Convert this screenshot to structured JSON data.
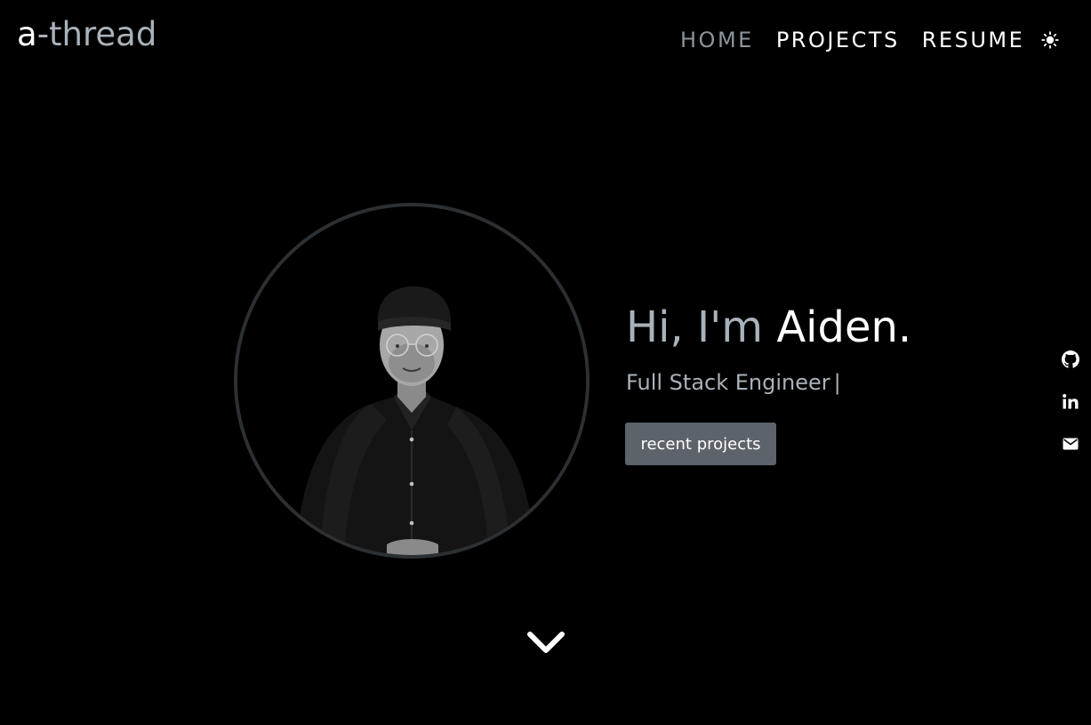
{
  "brand": {
    "first": "a",
    "rest": "-thread"
  },
  "nav": {
    "items": [
      {
        "label": "HOME",
        "active": true
      },
      {
        "label": "PROJECTS"
      },
      {
        "label": "RESUME"
      }
    ],
    "theme_toggle_icon": "sun-icon"
  },
  "hero": {
    "greeting_prefix": "Hi, I'm ",
    "name": "Aiden.",
    "role": "Full Stack Engineer",
    "cursor": "|",
    "cta_label": "recent projects",
    "avatar_icon": "profile-photo"
  },
  "socials": [
    {
      "icon": "github-icon"
    },
    {
      "icon": "linkedin-icon"
    },
    {
      "icon": "email-icon"
    }
  ],
  "scroll_indicator_icon": "chevron-down-icon",
  "colors": {
    "background": "#000000",
    "muted_text": "#a9b2ba",
    "active_nav": "#8d959c",
    "button_bg": "#5d636a",
    "ring": "#2c3033"
  }
}
